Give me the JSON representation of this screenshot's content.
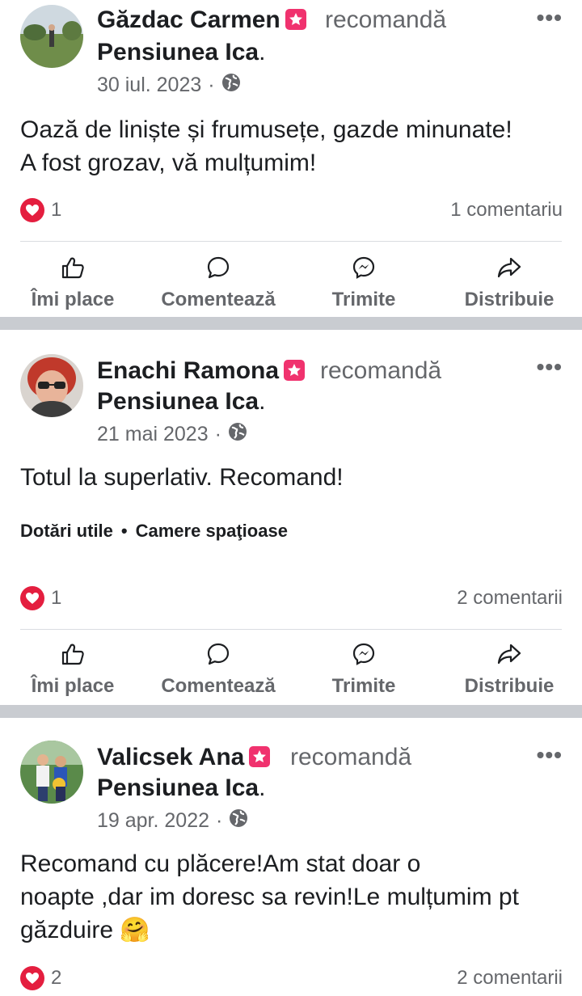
{
  "posts": [
    {
      "author": "Găzdac Carmen",
      "verb": "recomandă",
      "page": "Pensiunea Ica",
      "date": "30 iul. 2023",
      "text_lines": [
        "Oază de liniște și frumusețe, gazde minunate!",
        "A fost  grozav, vă mulțumim!"
      ],
      "reaction_count": "1",
      "comments": "1 comentariu"
    },
    {
      "author": "Enachi Ramona",
      "verb": "recomandă",
      "page": "Pensiunea Ica",
      "date": "21 mai 2023",
      "text_lines": [
        "Totul la superlativ. Recomand!"
      ],
      "tags": [
        "Dotări utile",
        "Camere spaţioase"
      ],
      "reaction_count": "1",
      "comments": "2 comentarii"
    },
    {
      "author": "Valicsek Ana",
      "verb": "recomandă",
      "page": "Pensiunea Ica",
      "date": "19 apr. 2022",
      "text_lines": [
        "Recomand cu plăcere!Am stat doar o",
        "noapte ,dar im doresc sa revin!Le mulțumim pt",
        "găzduire 🤗"
      ],
      "reaction_count": "2",
      "comments": "2 comentarii"
    }
  ],
  "actions": {
    "like": "Îmi place",
    "comment": "Comentează",
    "send": "Trimite",
    "share": "Distribuie"
  },
  "punct": ".",
  "meta_separator": "·",
  "tag_separator": "•",
  "more_glyph": "•••",
  "icons": {
    "badge": "recommend-badge-icon",
    "globe": "globe-icon",
    "heart": "love-reaction-icon",
    "like": "thumbs-up-icon",
    "comment": "comment-bubble-icon",
    "send": "messenger-icon",
    "share": "share-arrow-icon"
  },
  "colors": {
    "badge": "#f0326e",
    "heart": "#e41e3f",
    "separator": "#c9ccd1",
    "secondary_text": "#65676b"
  }
}
